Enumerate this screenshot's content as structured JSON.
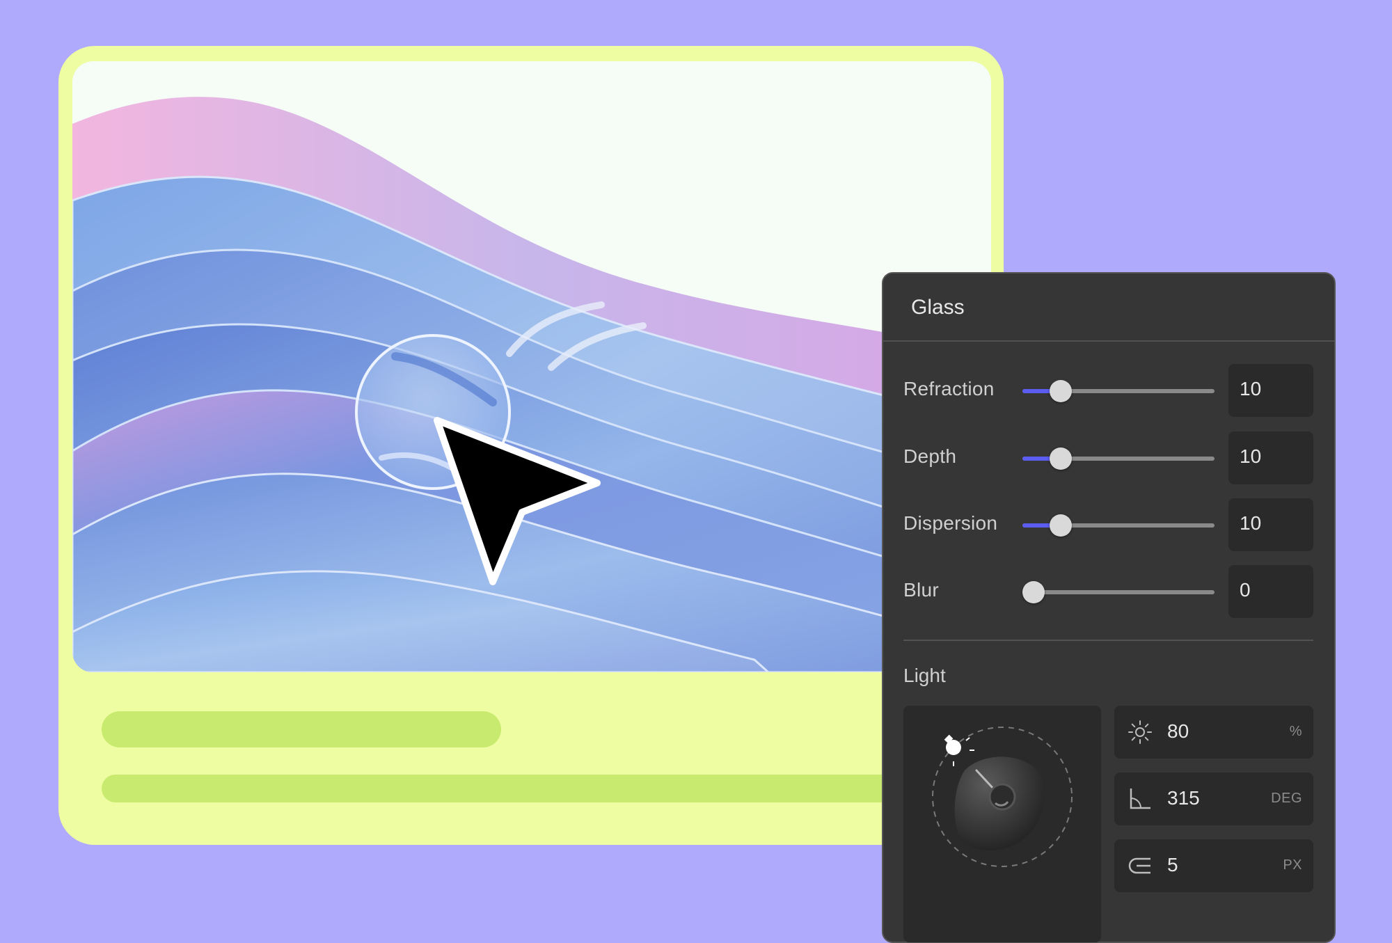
{
  "panel": {
    "title": "Glass",
    "sliders": [
      {
        "label": "Refraction",
        "value": "10",
        "fraction": 0.15
      },
      {
        "label": "Depth",
        "value": "10",
        "fraction": 0.15
      },
      {
        "label": "Dispersion",
        "value": "10",
        "fraction": 0.15
      },
      {
        "label": "Blur",
        "value": "0",
        "fraction": 0.0
      }
    ],
    "light": {
      "label": "Light",
      "brightness": {
        "value": "80",
        "unit": "%",
        "icon": "sun-icon"
      },
      "angle": {
        "value": "315",
        "unit": "DEG",
        "icon": "angle-icon"
      },
      "size": {
        "value": "5",
        "unit": "PX",
        "icon": "radius-icon"
      }
    }
  },
  "colors": {
    "background": "#b0aafd",
    "card": "#eefca2",
    "skeleton": "#c8ea6e",
    "panel": "#363636",
    "accent": "#5b5cf0"
  }
}
